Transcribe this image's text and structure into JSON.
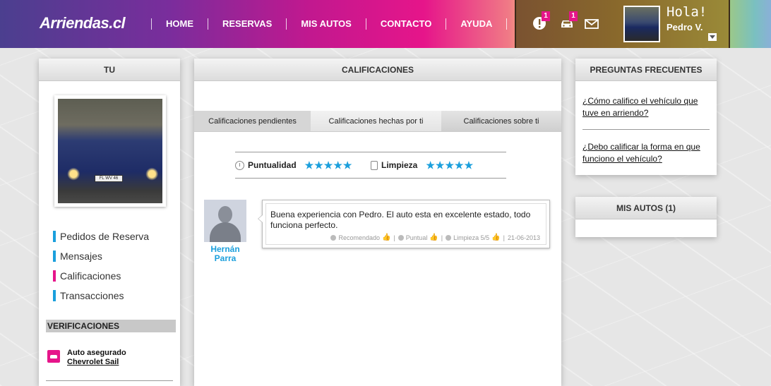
{
  "header": {
    "logo": "Arriendas.cl",
    "nav": [
      {
        "label": "HOME"
      },
      {
        "label": "RESERVAS"
      },
      {
        "label": "MIS AUTOS"
      },
      {
        "label": "CONTACTO"
      },
      {
        "label": "AYUDA"
      }
    ],
    "alerts_badge": "1",
    "cars_badge": "1",
    "greeting": "Hola!",
    "user_name": "Pedro V."
  },
  "left": {
    "title": "TU",
    "plate": "FL WV 46",
    "menu": [
      {
        "label": "Pedidos de Reserva"
      },
      {
        "label": "Mensajes"
      },
      {
        "label": "Calificaciones"
      },
      {
        "label": "Transacciones"
      }
    ],
    "verifications_title": "VERIFICACIONES",
    "verification_item": "Auto asegurado",
    "verification_link": "Chevrolet Sail"
  },
  "main": {
    "title": "CALIFICACIONES",
    "tabs": [
      {
        "label": "Calificaciones pendientes"
      },
      {
        "label": "Calificaciones hechas por ti"
      },
      {
        "label": "Calificaciones sobre ti"
      }
    ],
    "ratings": [
      {
        "label": "Puntualidad",
        "stars": "★★★★★"
      },
      {
        "label": "Limpieza",
        "stars": "★★★★★"
      }
    ],
    "review": {
      "reviewer_first": "Hernán",
      "reviewer_last": "Parra",
      "text": "Buena experiencia con Pedro. El auto esta en excelente estado, todo funciona perfecto.",
      "meta": {
        "recomendado": "Recomendado",
        "puntual": "Puntual",
        "limpieza": "Limpieza 5/5",
        "date": "21-06-2013"
      }
    }
  },
  "right": {
    "faq_title": "PREGUNTAS FRECUENTES",
    "faqs": [
      {
        "label": "¿Cómo califico el vehículo que tuve en arriendo?"
      },
      {
        "label": "¿Debo calificar la forma en que funciono el vehículo?"
      }
    ],
    "my_cars_title": "MIS AUTOS (1)"
  },
  "colors": {
    "accent_blue": "#1a9fdc",
    "accent_pink": "#e6158a"
  }
}
